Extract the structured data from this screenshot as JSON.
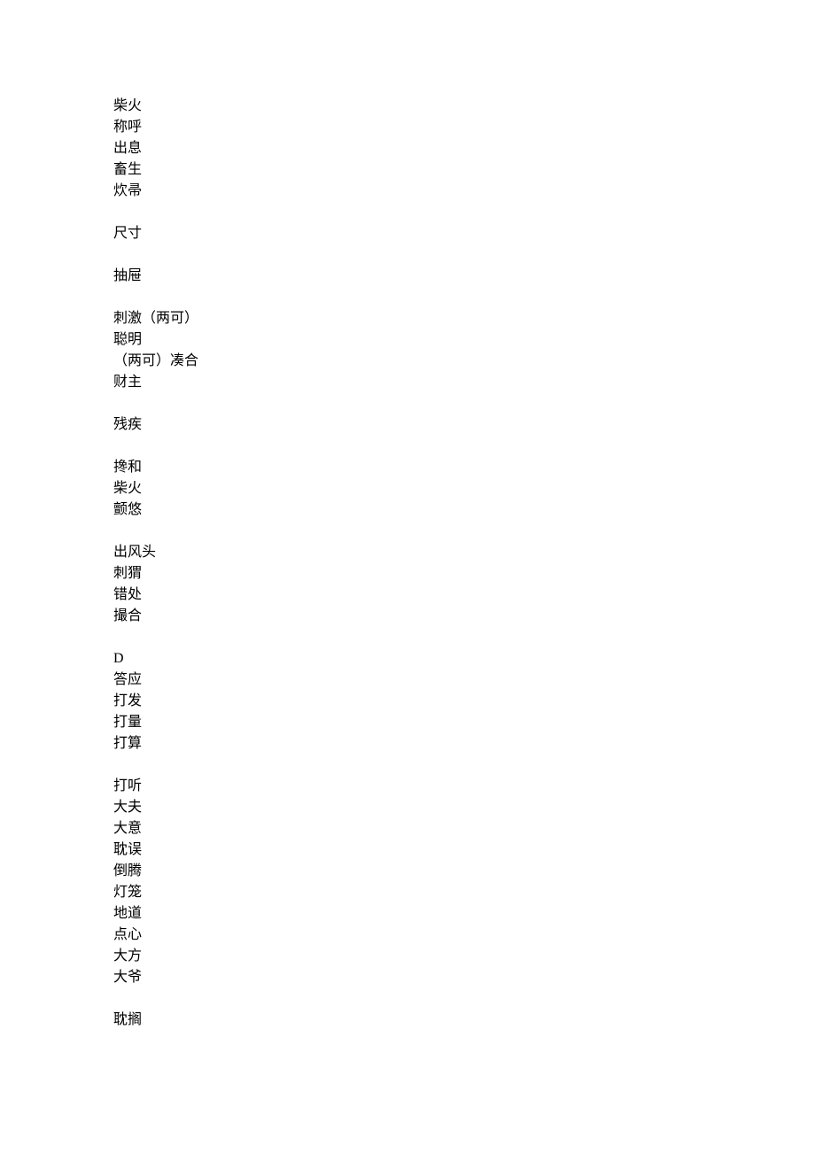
{
  "groups": [
    [
      "柴火",
      "称呼",
      "出息",
      "畜生",
      "炊帚"
    ],
    [
      "尺寸"
    ],
    [
      "抽屉"
    ],
    [
      "刺激（两可）",
      "聪明",
      "（两可）凑合",
      "财主"
    ],
    [
      "残疾"
    ],
    [
      "搀和",
      "柴火",
      "颤悠"
    ],
    [
      "出风头",
      "刺猬",
      "错处",
      "撮合"
    ],
    [
      "D",
      "答应",
      "打发",
      "打量",
      "打算"
    ],
    [
      "打听",
      "大夫",
      "大意",
      "耽误",
      "倒腾",
      "灯笼",
      "地道",
      "点心",
      "大方",
      "大爷"
    ],
    [
      "耽搁"
    ]
  ]
}
